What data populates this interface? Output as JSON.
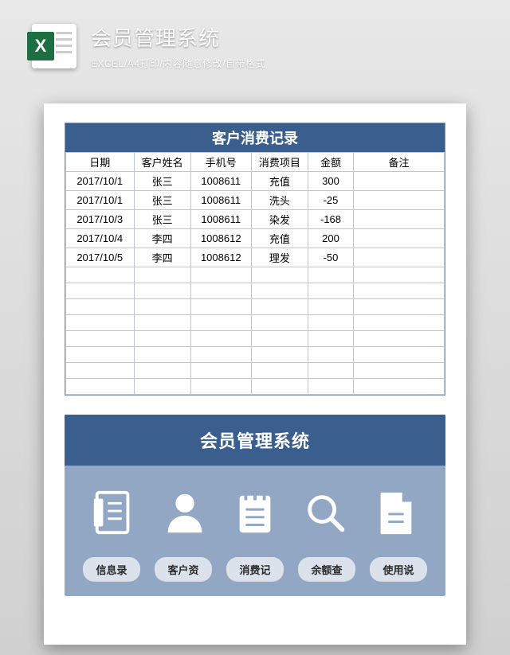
{
  "header": {
    "title": "会员管理系统",
    "subtitle": "EXCEL/A4打印/内容随意修改/自带格式",
    "file_type_label": "X"
  },
  "table": {
    "title": "客户消费记录",
    "columns": [
      "日期",
      "客户姓名",
      "手机号",
      "消费项目",
      "金额",
      "备注"
    ],
    "rows": [
      {
        "date": "2017/10/1",
        "name": "张三",
        "phone": "1008611",
        "item": "充值",
        "amount": "300",
        "note": ""
      },
      {
        "date": "2017/10/1",
        "name": "张三",
        "phone": "1008611",
        "item": "洗头",
        "amount": "-25",
        "note": ""
      },
      {
        "date": "2017/10/3",
        "name": "张三",
        "phone": "1008611",
        "item": "染发",
        "amount": "-168",
        "note": ""
      },
      {
        "date": "2017/10/4",
        "name": "李四",
        "phone": "1008612",
        "item": "充值",
        "amount": "200",
        "note": ""
      },
      {
        "date": "2017/10/5",
        "name": "李四",
        "phone": "1008612",
        "item": "理发",
        "amount": "-50",
        "note": ""
      }
    ],
    "empty_rows": 8
  },
  "panel": {
    "title": "会员管理系统",
    "icons": [
      "document-icon",
      "person-icon",
      "notepad-icon",
      "magnifier-icon",
      "file-icon"
    ],
    "buttons": [
      "信息录",
      "客户资",
      "消费记",
      "余额查",
      "使用说"
    ]
  }
}
